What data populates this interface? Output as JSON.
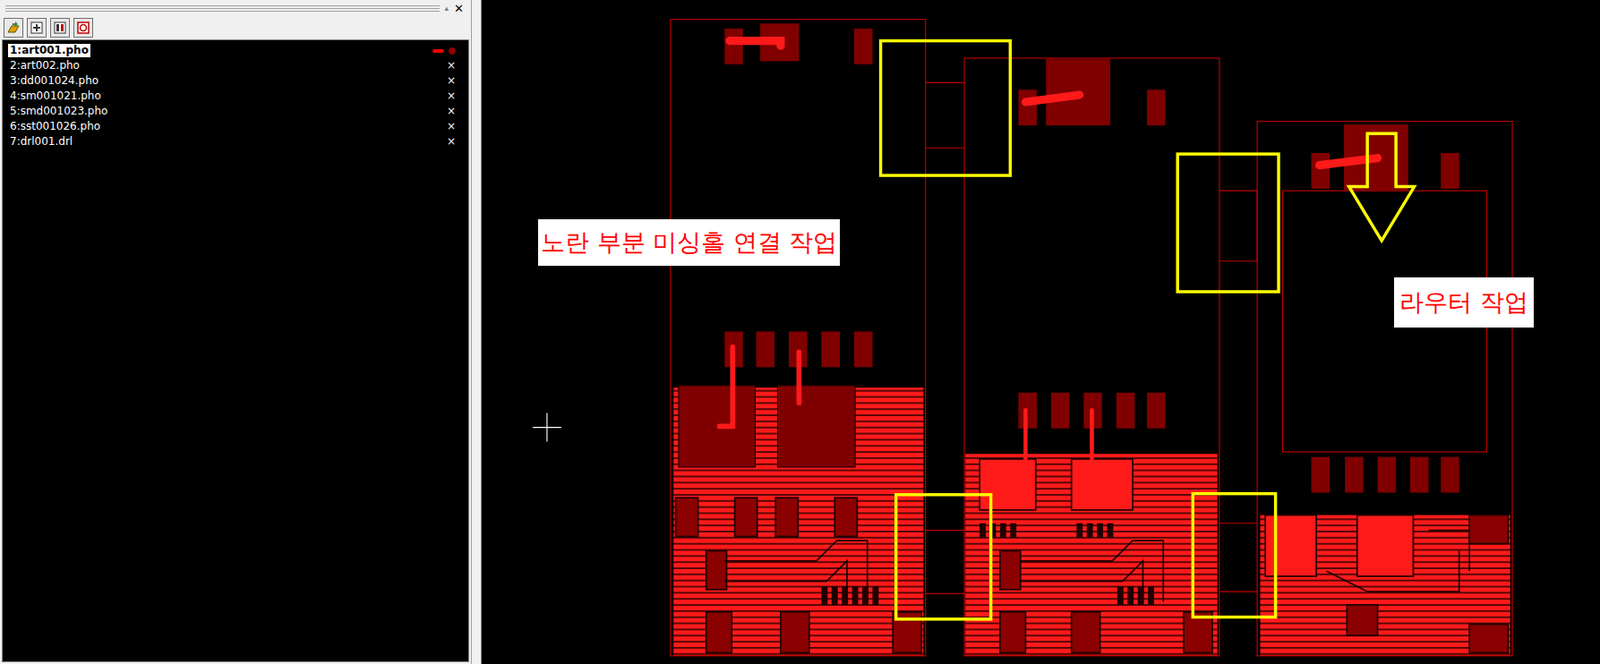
{
  "panel": {
    "scroll_glyph": "▴",
    "close_glyph": "✕",
    "hidden_glyph": "×"
  },
  "layers": [
    {
      "label": "1:art001.pho",
      "selected": true,
      "visible": true,
      "color": "#ff0000"
    },
    {
      "label": "2:art002.pho",
      "selected": false,
      "visible": false,
      "color": "#ffffff"
    },
    {
      "label": "3:dd001024.pho",
      "selected": false,
      "visible": false,
      "color": "#ffffff"
    },
    {
      "label": "4:sm001021.pho",
      "selected": false,
      "visible": false,
      "color": "#ffffff"
    },
    {
      "label": "5:smd001023.pho",
      "selected": false,
      "visible": false,
      "color": "#ffffff"
    },
    {
      "label": "6:sst001026.pho",
      "selected": false,
      "visible": false,
      "color": "#ffffff"
    },
    {
      "label": "7:drl001.drl",
      "selected": false,
      "visible": false,
      "color": "#ffffff"
    }
  ],
  "annotations": [
    {
      "text": "노란 부분 미싱홀 연결 작업"
    },
    {
      "text": "라우터 작업"
    }
  ]
}
